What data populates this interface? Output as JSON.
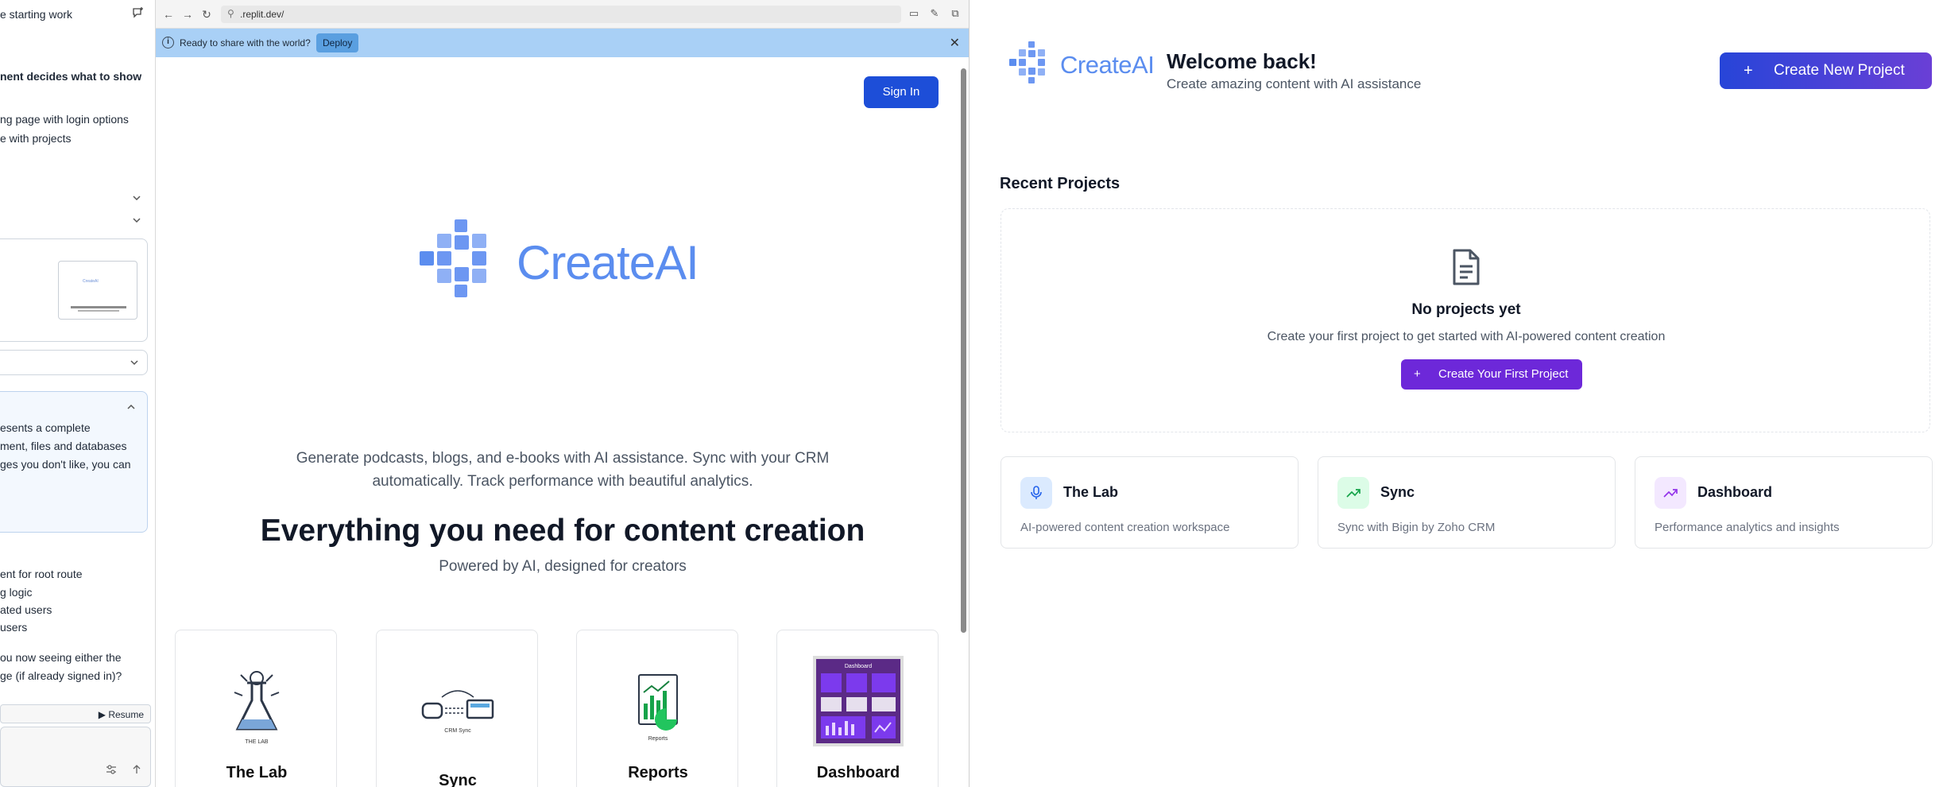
{
  "chat": {
    "header_title": "e starting work",
    "lines": [
      {
        "text": "nent decides what to show",
        "bold": true
      },
      {
        "text": "ng page with login options",
        "bold": false
      },
      {
        "text": "e with projects",
        "bold": false
      }
    ],
    "blue_card_lines": [
      "esents a complete",
      "ment, files and databases",
      "ges you don't like, you can"
    ],
    "bottom_lines": [
      "ent for root route",
      "g logic",
      "ated users",
      "users"
    ],
    "question_lines": [
      "ou now seeing either the",
      "ge (if already signed in)?"
    ],
    "resume_label": "▶  Resume",
    "thumb_brand": "CreateAI"
  },
  "browser": {
    "url": ".replit.dev/",
    "banner_text": "Ready to share with the world?",
    "deploy_label": "Deploy",
    "signin_label": "Sign In",
    "brand": "CreateAI",
    "hero_paragraph": "Generate podcasts, blogs, and e-books with AI assistance. Sync with your CRM automatically. Track performance with beautiful analytics.",
    "hero_heading": "Everything you need for content creation",
    "hero_sub": "Powered by AI, designed for creators",
    "features": [
      {
        "title": "The Lab",
        "caption": "THE LAB"
      },
      {
        "title": "Sync",
        "caption": "CRM Sync"
      },
      {
        "title": "Reports",
        "caption": "Reports"
      },
      {
        "title": "Dashboard",
        "caption": "Dashboard"
      }
    ]
  },
  "app": {
    "brand": "CreateAI",
    "welcome_title": "Welcome back!",
    "welcome_sub": "Create amazing content with AI assistance",
    "new_project_label": "Create New Project",
    "recent_title": "Recent Projects",
    "empty_title": "No projects yet",
    "empty_sub": "Create your first project to get started with AI-powered content creation",
    "empty_cta": "Create Your First Project",
    "cards": [
      {
        "name": "The Lab",
        "desc": "AI-powered content creation workspace",
        "icon": "microphone-icon",
        "bg": "#dbeafe",
        "fg": "#2563eb"
      },
      {
        "name": "Sync",
        "desc": "Sync with Bigin by Zoho CRM",
        "icon": "trending-up-icon",
        "bg": "#dcfce7",
        "fg": "#16a34a"
      },
      {
        "name": "Dashboard",
        "desc": "Performance analytics and insights",
        "icon": "trending-up-icon",
        "bg": "#f3e8ff",
        "fg": "#9333ea"
      }
    ]
  },
  "colors": {
    "brand_blue": "#5b8def",
    "primary": "#1d4ed8",
    "purple": "#6d28d9",
    "banner": "#a9d0f6"
  }
}
